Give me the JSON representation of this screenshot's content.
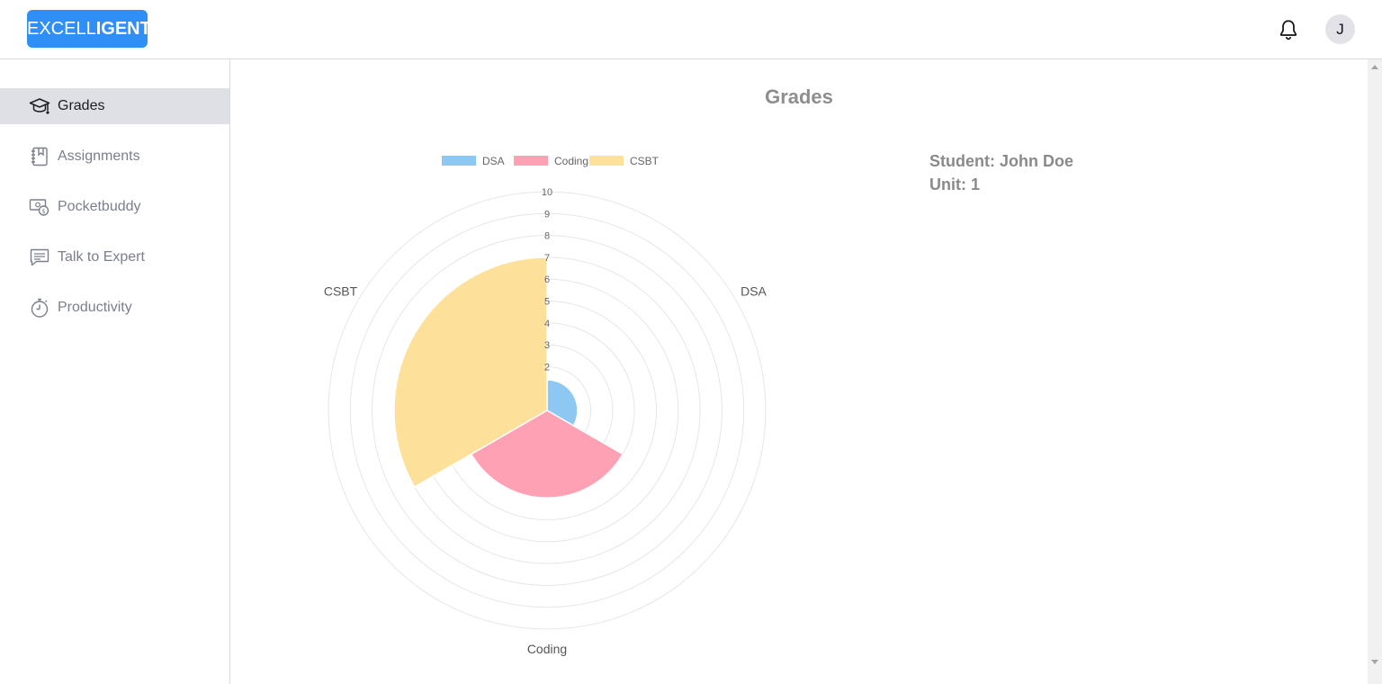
{
  "header": {
    "logo_light": "EXCELL",
    "logo_bold": "IGENT",
    "avatar_initial": "J",
    "bell_icon": "bell-icon"
  },
  "sidebar": {
    "items": [
      {
        "label": "Grades",
        "icon": "graduation-cap-icon",
        "active": true
      },
      {
        "label": "Assignments",
        "icon": "notebook-icon",
        "active": false
      },
      {
        "label": "Pocketbuddy",
        "icon": "money-icon",
        "active": false
      },
      {
        "label": "Talk to Expert",
        "icon": "chat-icon",
        "active": false
      },
      {
        "label": "Productivity",
        "icon": "stopwatch-icon",
        "active": false
      }
    ]
  },
  "main": {
    "title": "Grades",
    "student_line": "Student: John Doe",
    "unit_line": "Unit: 1"
  },
  "colors": {
    "accent": "#2f8ff7",
    "dsa": "#8cc8f2",
    "coding": "#ffa1b4",
    "csbt": "#fde09a"
  },
  "chart_data": {
    "type": "polarArea",
    "categories": [
      "DSA",
      "Coding",
      "CSBT"
    ],
    "values": [
      1.4,
      4.0,
      7.0
    ],
    "legend": [
      "DSA",
      "Coding",
      "CSBT"
    ],
    "legend_position": "top",
    "rlim": [
      0,
      10
    ],
    "ticks": [
      "2",
      "3",
      "4",
      "5",
      "6",
      "7",
      "8",
      "9",
      "10"
    ],
    "grid": true
  }
}
